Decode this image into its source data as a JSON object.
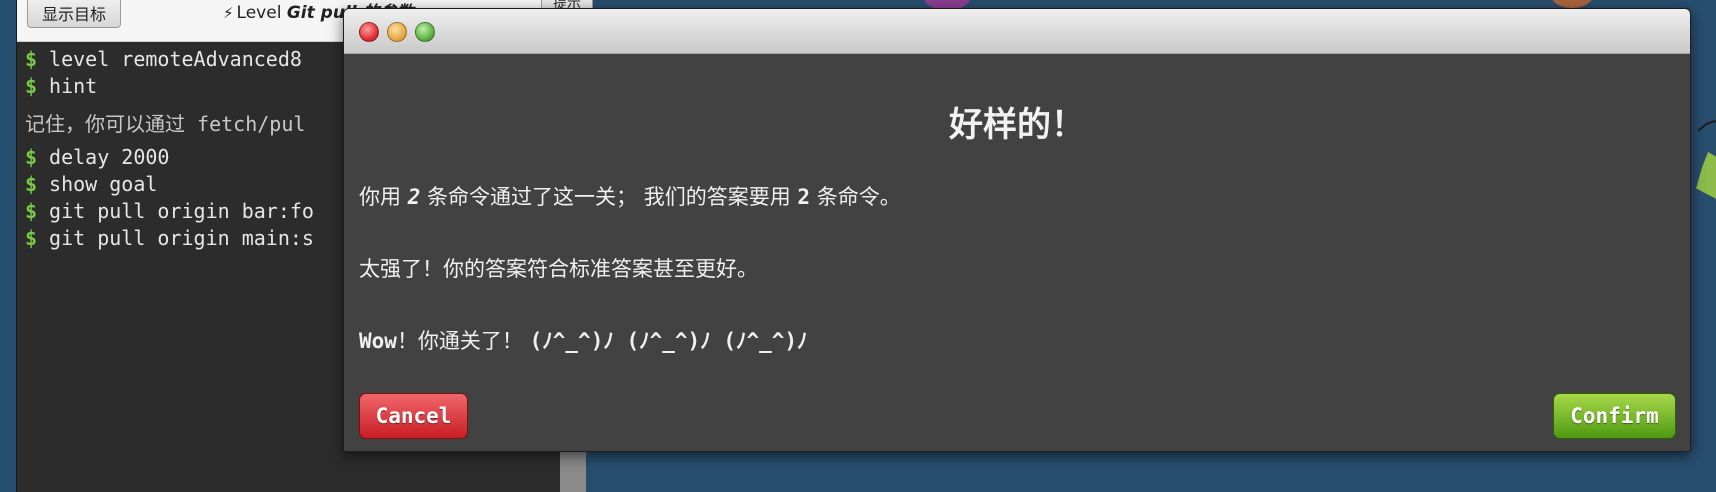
{
  "terminal": {
    "show_goal_button": "显示目标",
    "level_prefix": "Level",
    "level_name": "Git pull 的参数",
    "hint_button": "提示",
    "prompt_symbol": "$",
    "lines_top": [
      "level remoteAdvanced8",
      "hint"
    ],
    "hint_note": "记住，你可以通过 fetch/pul",
    "lines_bottom": [
      "delay 2000",
      "show goal",
      "git pull origin bar:fo",
      "git pull origin main:s"
    ]
  },
  "dialog": {
    "heading": "好样的！",
    "line1_a": "你用 ",
    "line1_count": "2",
    "line1_b": " 条命令通过了这一关；  我们的答案要用 ",
    "line1_solution": "2",
    "line1_c": " 条命令。",
    "line2": "太强了！你的答案符合标准答案甚至更好。",
    "line3_a": "Wow",
    "line3_b": "！你通关了！ ",
    "line3_c": "(ﾉ^_^)ﾉ (ﾉ^_^)ﾉ (ﾉ^_^)ﾉ",
    "cancel_label": "Cancel",
    "confirm_label": "Confirm"
  },
  "colors": {
    "background": "#284e6e",
    "terminal_bg": "#2c2c2c",
    "prompt": "#7ac943",
    "dialog_bg": "#424242",
    "cancel": "#c91d24",
    "confirm": "#4f9a12"
  }
}
